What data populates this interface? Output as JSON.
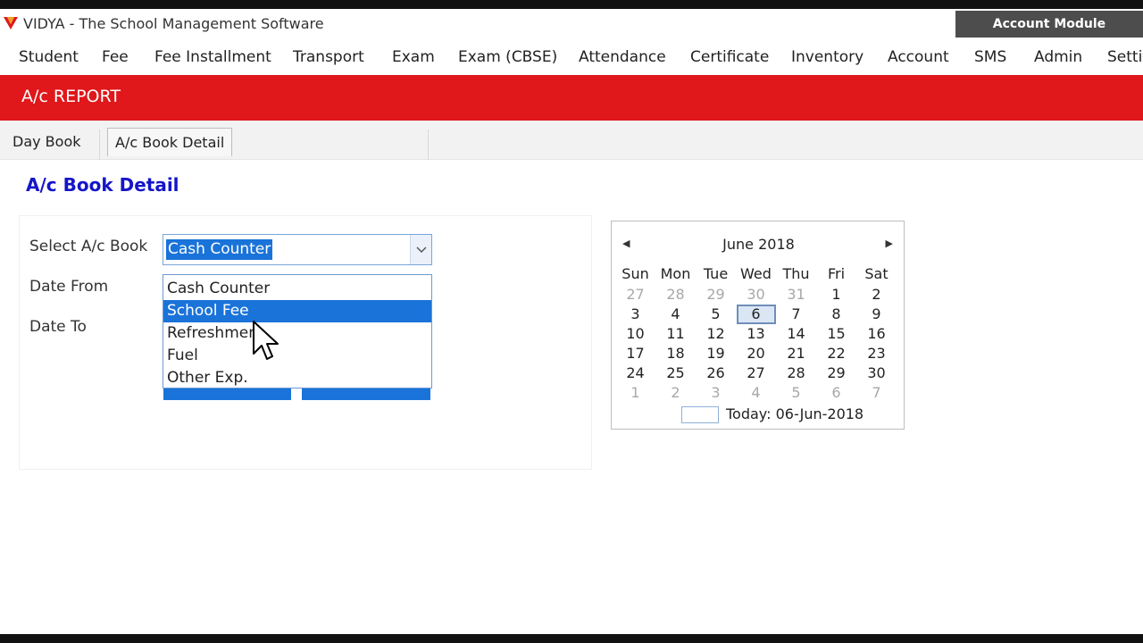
{
  "app": {
    "title": "VIDYA - The School Management Software",
    "module": "Account Module",
    "brand_color": "#e0171b",
    "accent_color": "#1a73d9"
  },
  "menu": [
    "Student",
    "Fee",
    "Fee Installment",
    "Transport",
    "Exam",
    "Exam (CBSE)",
    "Attendance",
    "Certificate",
    "Inventory",
    "Account",
    "SMS",
    "Admin",
    "Setti"
  ],
  "section": {
    "title": "A/c REPORT"
  },
  "tabs": [
    {
      "label": "Day Book",
      "active": false
    },
    {
      "label": "A/c Book Detail",
      "active": true
    }
  ],
  "page": {
    "title": "A/c Book Detail"
  },
  "form": {
    "select_label": "Select A/c Book",
    "date_from_label": "Date From",
    "date_to_label": "Date To",
    "selected_value": "Cash Counter",
    "options": [
      "Cash Counter",
      "School Fee",
      "Refreshmen",
      "Fuel",
      "Other Exp."
    ],
    "hovered_option": "School Fee"
  },
  "calendar": {
    "month_title": "June 2018",
    "weekdays": [
      "Sun",
      "Mon",
      "Tue",
      "Wed",
      "Thu",
      "Fri",
      "Sat"
    ],
    "weeks": [
      [
        "27",
        "28",
        "29",
        "30",
        "31",
        "1",
        "2"
      ],
      [
        "3",
        "4",
        "5",
        "6",
        "7",
        "8",
        "9"
      ],
      [
        "10",
        "11",
        "12",
        "13",
        "14",
        "15",
        "16"
      ],
      [
        "17",
        "18",
        "19",
        "20",
        "21",
        "22",
        "23"
      ],
      [
        "24",
        "25",
        "26",
        "27",
        "28",
        "29",
        "30"
      ],
      [
        "1",
        "2",
        "3",
        "4",
        "5",
        "6",
        "7"
      ]
    ],
    "selected_day": "6",
    "today_label": "Today: 06-Jun-2018",
    "prev_icon": "triangle-left",
    "next_icon": "triangle-right"
  }
}
